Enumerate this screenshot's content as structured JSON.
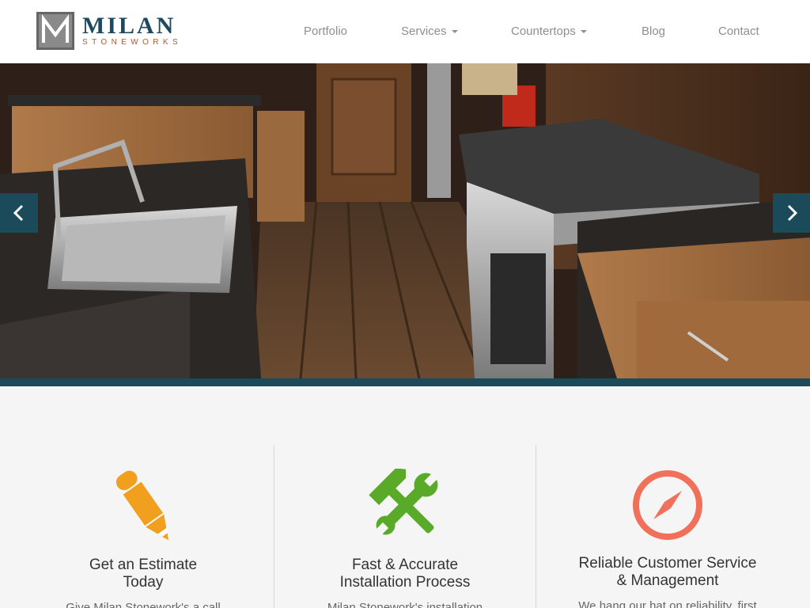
{
  "brand": {
    "name": "MILAN",
    "tagline": "STONEWORKS",
    "accent_color": "#1d4a5e",
    "tagline_color": "#c0542c"
  },
  "nav": {
    "items": [
      {
        "label": "Portfolio",
        "has_dropdown": false
      },
      {
        "label": "Services",
        "has_dropdown": true
      },
      {
        "label": "Countertops",
        "has_dropdown": true
      },
      {
        "label": "Blog",
        "has_dropdown": false
      },
      {
        "label": "Contact",
        "has_dropdown": false
      }
    ]
  },
  "hero": {
    "prev_icon": "chevron-left-icon",
    "next_icon": "chevron-right-icon",
    "strip_color": "#1b4a5a"
  },
  "features": [
    {
      "icon": "pencil-icon",
      "icon_color": "#f0a01e",
      "title_line1": "Get an Estimate",
      "title_line2": "Today",
      "text": "Give Milan Stonework's a call"
    },
    {
      "icon": "tools-icon",
      "icon_color": "#5aaa2a",
      "title_line1": "Fast & Accurate",
      "title_line2": "Installation Process",
      "text": "Milan Stonework's installation"
    },
    {
      "icon": "compass-icon",
      "icon_color": "#f0705a",
      "title_line1": "Reliable Customer Service",
      "title_line2": "& Management",
      "text": "We hang our hat on reliability, first"
    }
  ]
}
